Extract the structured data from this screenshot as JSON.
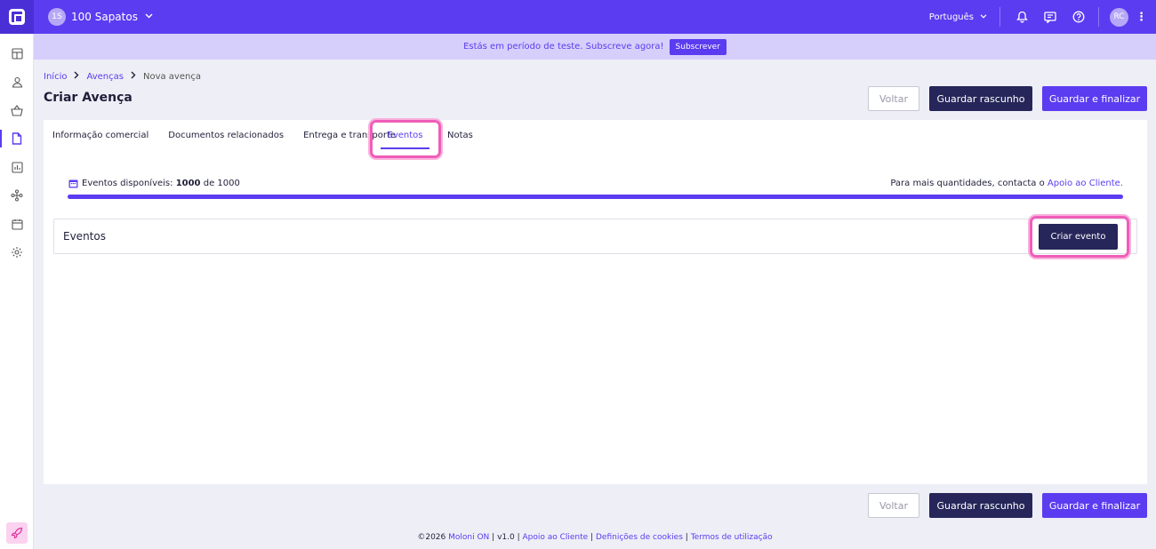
{
  "topbar": {
    "company_initials": "1S",
    "company_name": "100 Sapatos",
    "language": "Português",
    "user_initials": "RC",
    "brand_color": "#5b3cf0"
  },
  "banner": {
    "text": "Estás em período de teste. Subscreve agora!",
    "button": "Subscrever"
  },
  "breadcrumb": {
    "home": "Início",
    "section": "Avenças",
    "current": "Nova avença"
  },
  "page": {
    "title": "Criar Avença",
    "back_label": "Voltar",
    "draft_label": "Guardar rascunho",
    "finalize_label": "Guardar e finalizar"
  },
  "tabs": [
    {
      "label": "Informação comercial"
    },
    {
      "label": "Documentos relacionados"
    },
    {
      "label": "Entrega e transporte"
    },
    {
      "label": "Eventos",
      "active": true
    },
    {
      "label": "Notas"
    }
  ],
  "quota": {
    "label": "Eventos disponíveis:",
    "used": "1000",
    "of": "de",
    "total": "1000",
    "fill_fraction": 1.0,
    "right_text": "Para mais quantidades, contacta o",
    "right_link": "Apoio ao Cliente."
  },
  "events": {
    "title": "Eventos",
    "create_label": "Criar evento"
  },
  "footer": {
    "copyright": "©2026",
    "brand": "Moloni ON",
    "version": "| v1.0 |",
    "support": "Apoio ao Cliente",
    "cookies": "Definições de cookies",
    "terms": "Termos de utilização",
    "sep": "|"
  }
}
